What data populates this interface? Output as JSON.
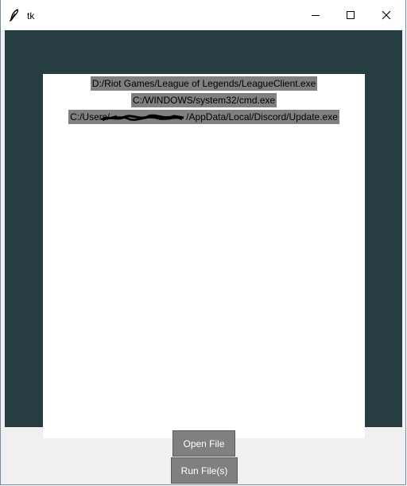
{
  "window": {
    "title": "tk",
    "icons": {
      "app": "feather-icon",
      "minimize": "minimize-icon",
      "maximize": "maximize-icon",
      "close": "close-icon"
    }
  },
  "colors": {
    "frame": "#263d42",
    "canvas": "#ffffff",
    "label_bg": "#808080",
    "button_bg": "#808080",
    "button_text": "#ffffff"
  },
  "files": [
    {
      "path": "D:/Riot Games/League of Legends/LeagueClient.exe"
    },
    {
      "path": "C:/WINDOWS/system32/cmd.exe"
    },
    {
      "prefix": "C:/Users/",
      "suffix": "/AppData/Local/Discord/Update.exe"
    }
  ],
  "buttons": {
    "open_label": "Open File",
    "run_label": "Run File(s)"
  }
}
